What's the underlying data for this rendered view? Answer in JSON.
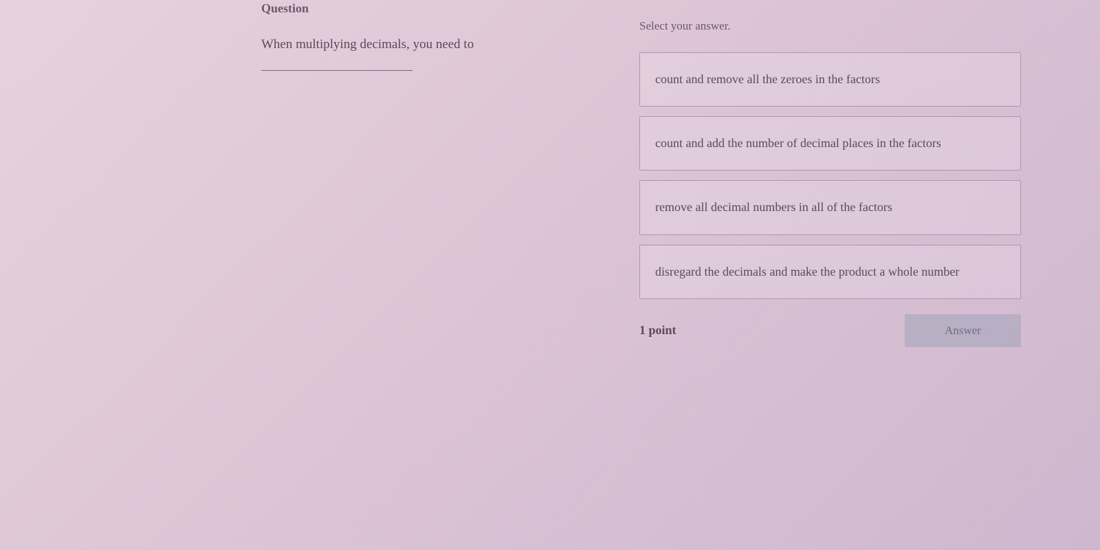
{
  "question": {
    "heading": "Question",
    "text": "When multiplying decimals, you need to"
  },
  "answer": {
    "heading": "Select your answer.",
    "options": [
      "count and remove all the zeroes in the factors",
      "count and add the number of decimal places in the factors",
      "remove all decimal numbers in all of the factors",
      "disregard the decimals and make the product a whole number"
    ],
    "points": "1 point",
    "button": "Answer"
  }
}
